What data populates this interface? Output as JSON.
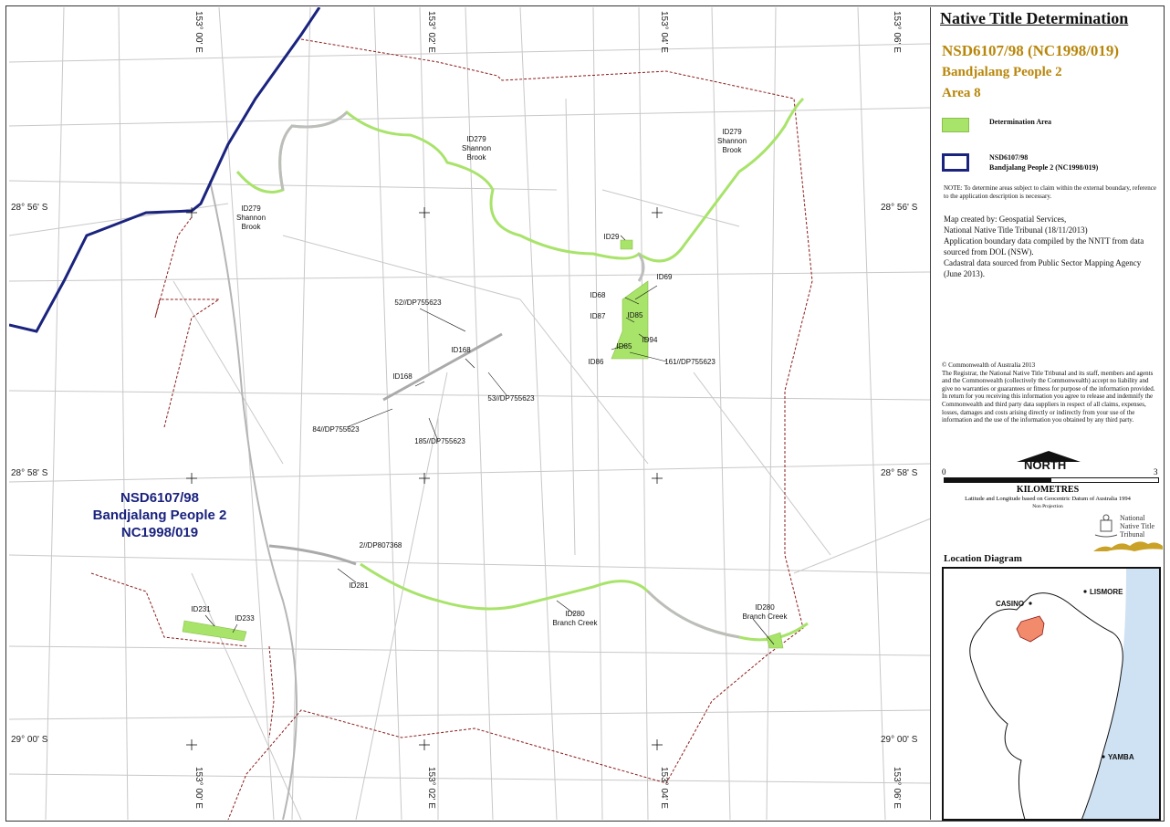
{
  "map": {
    "lon_ticks": [
      "153° 00' E",
      "153° 02' E",
      "153° 04' E",
      "153° 06' E"
    ],
    "lat_ticks": [
      "28° 56' S",
      "28° 58' S",
      "29° 00' S"
    ],
    "claim_label": {
      "line1": "NSD6107/98",
      "line2": "Bandjalang People 2",
      "line3": "NC1998/019"
    },
    "features": [
      "ID279",
      "Shannon",
      "Brook",
      "ID29",
      "ID69",
      "ID68",
      "ID87",
      "ID85",
      "ID94",
      "ID86",
      "161//DP755623",
      "52//DP755623",
      "ID168",
      "53//DP755623",
      "84//DP755623",
      "185//DP755623",
      "2//DP807368",
      "ID281",
      "ID280",
      "Branch Creek",
      "ID231",
      "ID233"
    ],
    "colors": {
      "determination_area": "#a8e36a",
      "claim_boundary": "#1a237e",
      "cadastre": "#c8c8c8",
      "dashed_boundary": "#8b1a1a"
    }
  },
  "panel": {
    "title": "Native Title Determination",
    "subtitle_1": "NSD6107/98  (NC1998/019)",
    "subtitle_2": "Bandjalang People 2",
    "subtitle_3": "Area 8",
    "legend": {
      "determination": "Determination Area",
      "claim_line1": "NSD6107/98",
      "claim_line2": "Bandjalang People 2 (NC1998/019)"
    },
    "note": "NOTE: To determine areas subject to claim within the external boundary, reference to the application description is necessary.",
    "credits": [
      "Map created by: Geospatial Services,",
      "National Native Title Tribunal    (18/11/2013)",
      "Application boundary data compiled by the NNTT from data sourced from DOL (NSW).",
      "Cadastral data sourced from Public Sector Mapping Agency (June 2013)."
    ],
    "copyright_title": "© Commonwealth of Australia 2013",
    "copyright_text": "The Registrar, the National Native Title Tribunal and its staff, members and agents and the Commonwealth (collectively the Commonwealth) accept no liability and give no warranties or guarantees or fitness for purpose of the information provided. In return for you receiving this information you agree to release and indemnify the Commonwealth and third party data suppliers in respect of all claims, expenses, losses, damages and costs arising directly or indirectly from your use of the information and the use of the information you obtained by any third party.",
    "north": "NORTH",
    "scale_start": "0",
    "scale_end": "3",
    "scale_unit": "KILOMETRES",
    "datum": "Latitude and Longitude based on Geocentric Datum of Australia 1994",
    "projection": "Non Projection",
    "logo_line1": "National",
    "logo_line2": "Native Title",
    "logo_line3": "Tribunal",
    "location_title": "Location Diagram",
    "locations": [
      "LISMORE",
      "CASINO",
      "YAMBA"
    ]
  }
}
